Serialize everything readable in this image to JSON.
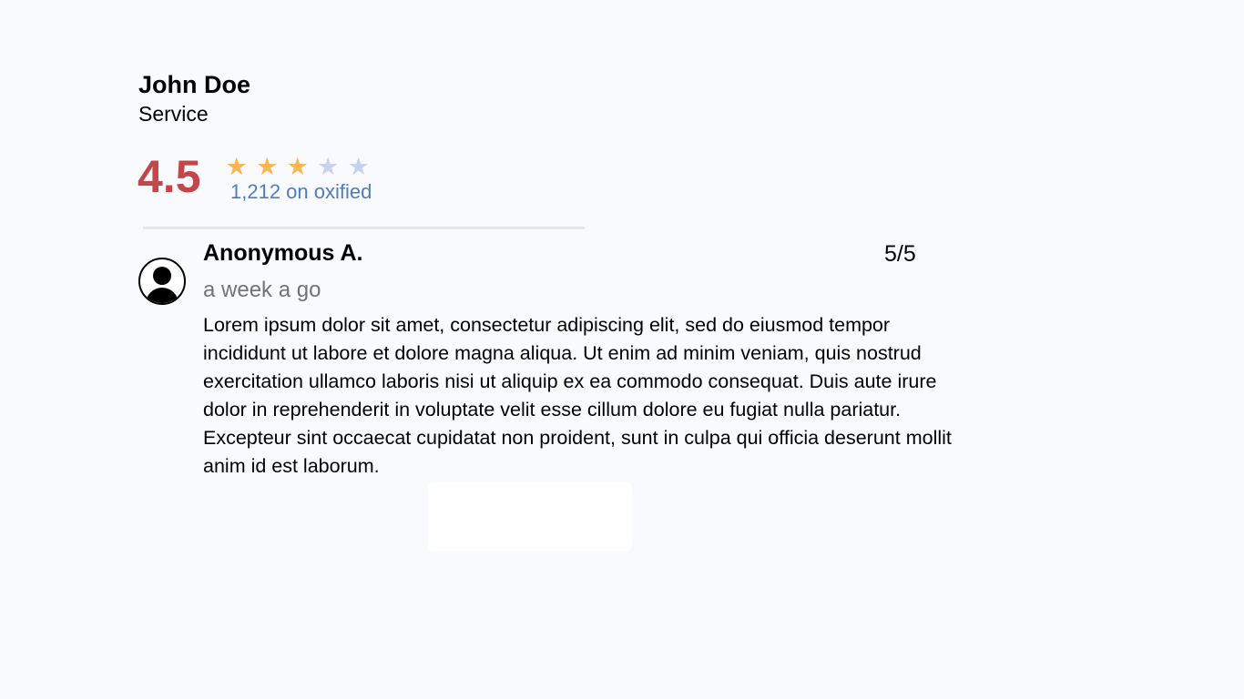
{
  "colors": {
    "background": "#f9fafe",
    "rating_score": "#c3474a",
    "star_filled": "#fbb650",
    "star_empty": "#c7d2ee",
    "rating_count": "#4f7cbf",
    "divider": "#dde8f6",
    "muted_text": "#737373"
  },
  "provider": {
    "name": "John Doe",
    "category": "Service"
  },
  "rating": {
    "score": "4.5",
    "stars_filled": 3,
    "stars_total": 5,
    "star_glyph": "★",
    "count_text": "1,212 on oxified"
  },
  "review": {
    "avatar_icon": "user-avatar-icon",
    "author": "Anonymous A.",
    "time": "a week a go",
    "score": "5/5",
    "text": "Lorem ipsum dolor sit amet, consectetur adipiscing elit, sed do eiusmod tempor incididunt ut labore et dolore magna aliqua. Ut enim ad minim veniam, quis nostrud exercitation ullamco laboris nisi ut aliquip ex ea commodo consequat. Duis aute irure dolor in reprehenderit in voluptate velit esse cillum dolore eu fugiat nulla pariatur. Excepteur sint occaecat cupidatat non proident, sunt in culpa qui officia deserunt mollit anim id est laborum."
  }
}
